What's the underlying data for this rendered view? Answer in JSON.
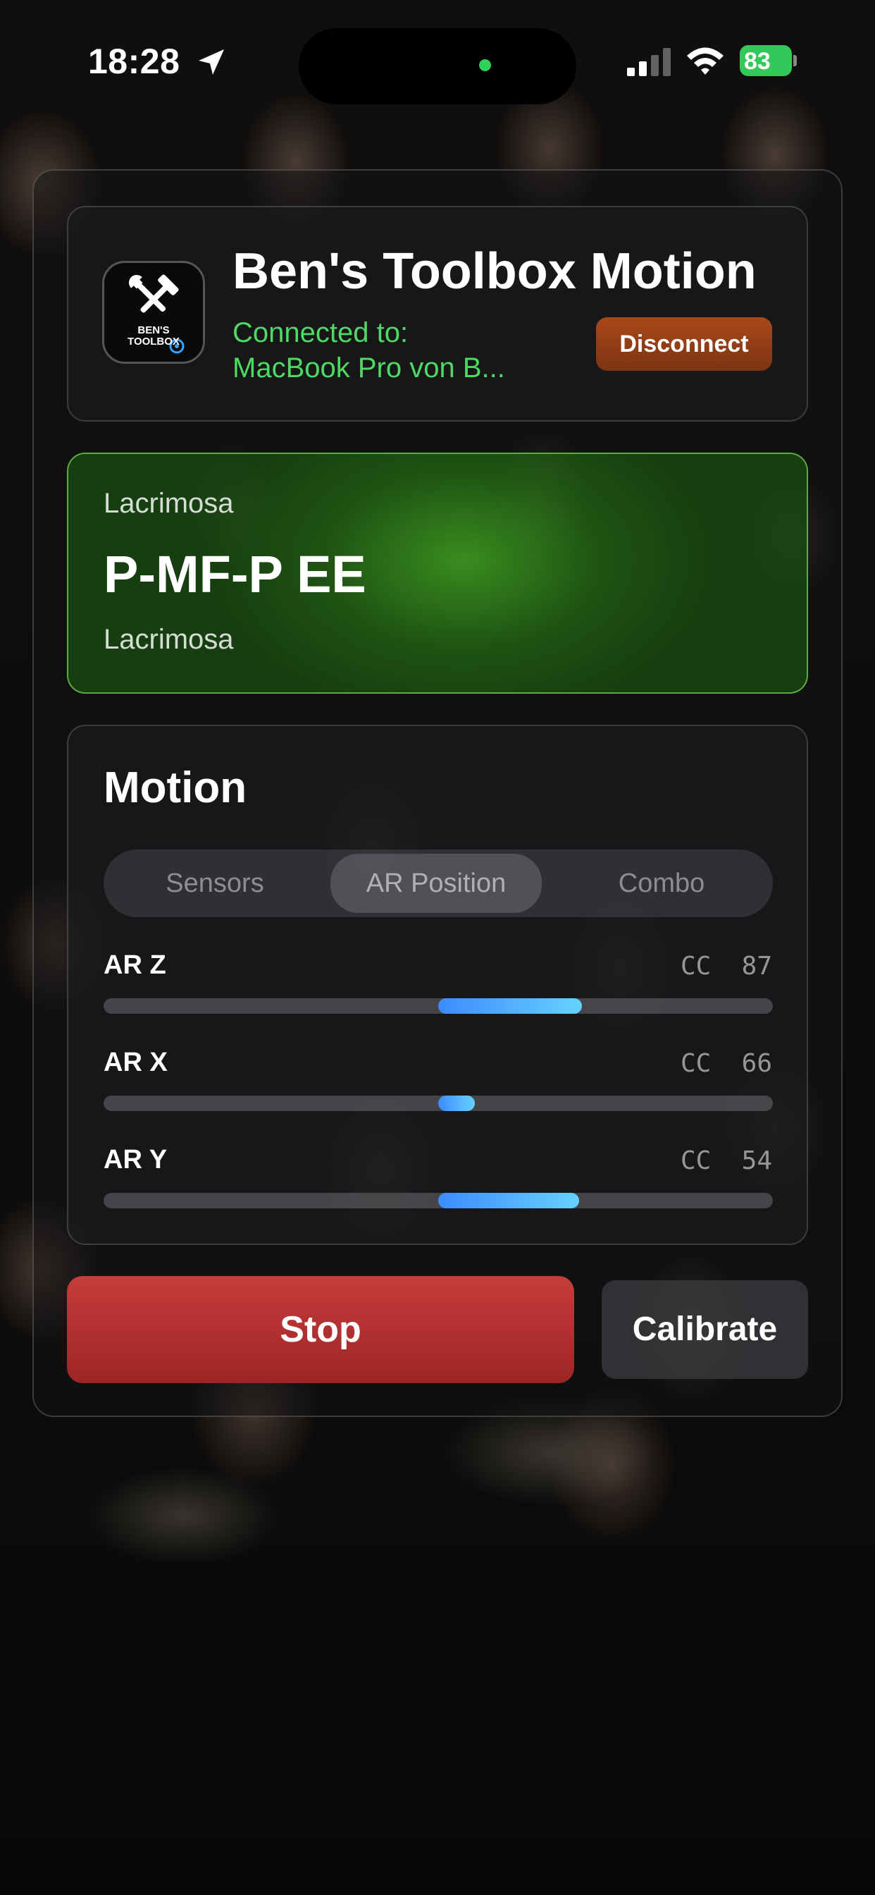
{
  "status_bar": {
    "time": "18:28",
    "battery": "83",
    "location_icon": "location-arrow-icon",
    "signal_icon": "cellular-signal-icon",
    "wifi_icon": "wifi-icon",
    "battery_icon": "battery-charging-icon"
  },
  "header": {
    "app_title": "Ben's Toolbox Motion",
    "app_icon": "bens-toolbox-app-icon",
    "app_icon_text_line1": "BEN'S",
    "app_icon_text_line2": "TOOLBOX",
    "connected_label": "Connected to:",
    "connected_device": "MacBook Pro von B...",
    "disconnect_label": "Disconnect"
  },
  "song": {
    "subtitle_top": "Lacrimosa",
    "title": "P-MF-P EE",
    "subtitle_bottom": "Lacrimosa"
  },
  "motion": {
    "title": "Motion",
    "tabs": [
      {
        "label": "Sensors",
        "selected": false
      },
      {
        "label": "AR Position",
        "selected": true
      },
      {
        "label": "Combo",
        "selected": false
      }
    ],
    "meters": [
      {
        "label": "AR Z",
        "cc": "CC  87",
        "range": [
          0.5,
          0.715
        ]
      },
      {
        "label": "AR X",
        "cc": "CC  66",
        "range": [
          0.5,
          0.555
        ]
      },
      {
        "label": "AR Y",
        "cc": "CC  54",
        "range": [
          0.5,
          0.71
        ]
      }
    ]
  },
  "actions": {
    "stop_label": "Stop",
    "calibrate_label": "Calibrate"
  },
  "colors": {
    "connected_green": "#4cd964",
    "disconnect_orange": "#a9481a",
    "stop_red": "#c63c3c",
    "meter_blue": "#3d8bff",
    "song_card_green": "#50c828"
  }
}
